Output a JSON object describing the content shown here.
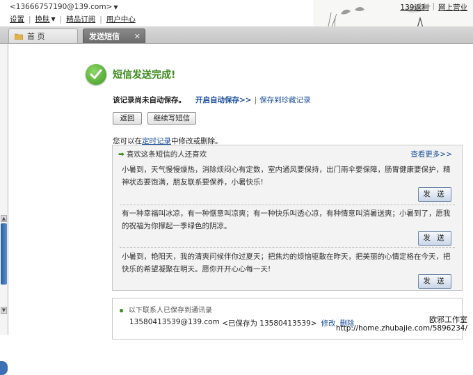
{
  "header": {
    "account": "<13666757190@139.com>",
    "menu": [
      "设置",
      "换肤",
      "精品订阅",
      "用户中心"
    ],
    "links": [
      "139返利",
      "网上营业"
    ]
  },
  "tabs": [
    {
      "label": "首 页",
      "active": false
    },
    {
      "label": "发送短信",
      "active": true,
      "close": "✕"
    }
  ],
  "status": {
    "title": "短信发送完成!",
    "notice": "该记录尚未自动保存。",
    "auto_save": "开启自动保存>>",
    "separator": "|",
    "save_link": "保存到珍藏记录"
  },
  "buttons": {
    "back": "返回",
    "continue": "继续写短信"
  },
  "info": {
    "prefix": "您可以在",
    "link": "定时记录",
    "suffix": "中修改或删除。"
  },
  "recommend": {
    "heading": "喜欢这条短信的人还喜欢",
    "more": "查看更多>>",
    "send_label": "发 送",
    "messages": [
      "小暑到，天气慢慢燥热，消除烦闷心有定数，室内通风要保持，出门雨伞要保障，肠胃健康要保护，精神状态要饱满，朋友联系要保养，小暑快乐!",
      "有一种幸福叫冰凉，有一种惬意叫凉爽；有一种快乐叫透心凉，有种情意叫消暑送爽；小暑到了，愿我的祝福为你撑起一季绿色的阴凉。",
      "小暑到，艳阳天，我的清爽问候伴你过夏天；把焦灼的烦恼驱散在昨天，把美丽的心情定格在今天，把快乐的希望凝聚在明天。愿你开开心心每一天!"
    ]
  },
  "contacts": {
    "heading": "以下联系人已保存到通讯录",
    "row": {
      "number": "13580413539@139.com",
      "saved": "<已保存为 13580413539>",
      "edit": "修改",
      "delete": "删除"
    }
  },
  "watermark": {
    "line1": "欧邪工作室",
    "line2": "http://home.zhubajie.com/5896234/"
  },
  "colors": {
    "success_green": "#3a8a1c",
    "link_blue": "#1b4f9c",
    "active_tab": "#6b6b6b"
  }
}
